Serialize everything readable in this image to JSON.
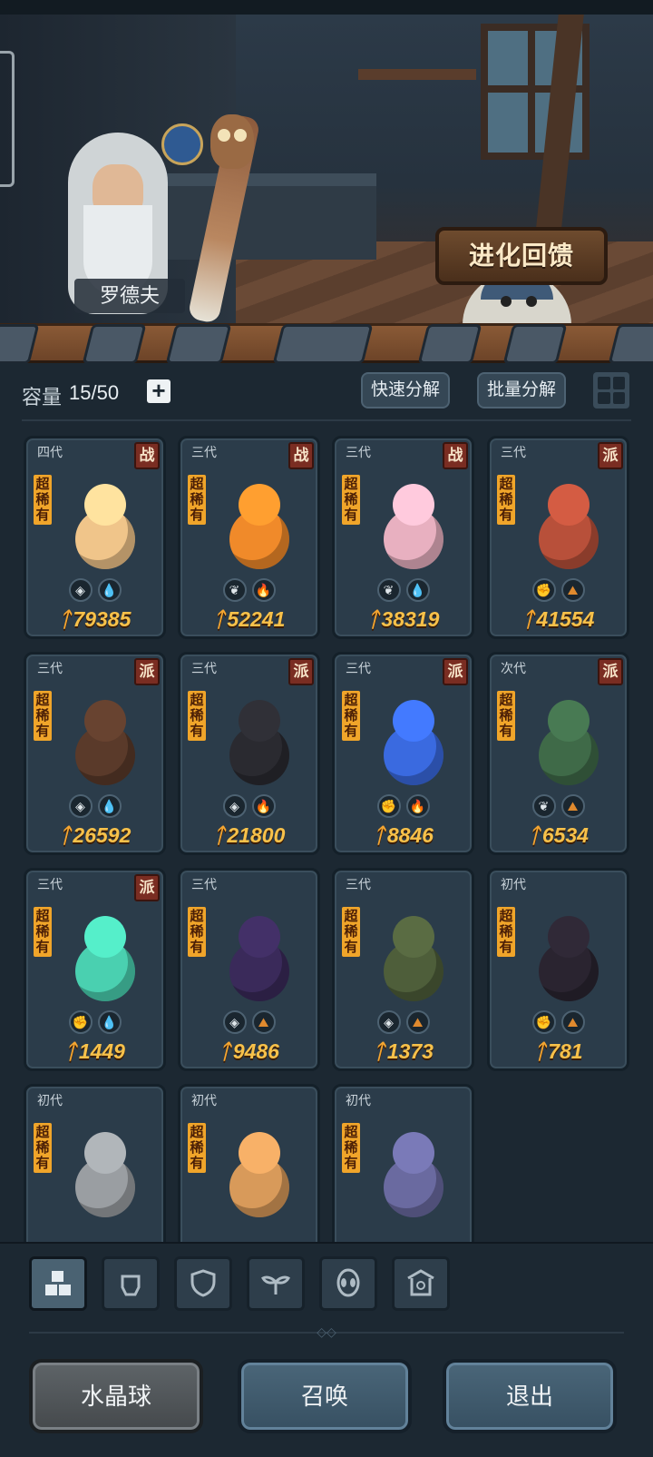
{
  "scene": {
    "npc_name": "罗德夫",
    "evolution_button": "进化回馈"
  },
  "capacity": {
    "label": "容量",
    "value": "15/50",
    "plus_symbol": "+"
  },
  "toolbar": {
    "quick_decompose": "快速分解",
    "batch_decompose": "批量分解"
  },
  "cards": [
    {
      "gen": "四代",
      "badge": "战",
      "rarity": "超稀有",
      "icons": [
        "shield-icon",
        "water-icon"
      ],
      "power": "79385",
      "color": "#f0c58a"
    },
    {
      "gen": "三代",
      "badge": "战",
      "rarity": "超稀有",
      "icons": [
        "leaf-icon",
        "fire-icon"
      ],
      "power": "52241",
      "color": "#f08a2a"
    },
    {
      "gen": "三代",
      "badge": "战",
      "rarity": "超稀有",
      "icons": [
        "leaf-icon",
        "water-icon"
      ],
      "power": "38319",
      "color": "#e8b0c0"
    },
    {
      "gen": "三代",
      "badge": "派",
      "rarity": "超稀有",
      "icons": [
        "fist-icon",
        "earth-icon"
      ],
      "power": "41554",
      "color": "#b8503a"
    },
    {
      "gen": "三代",
      "badge": "派",
      "rarity": "超稀有",
      "icons": [
        "shield-icon",
        "water-icon"
      ],
      "power": "26592",
      "color": "#5a3a2a"
    },
    {
      "gen": "三代",
      "badge": "派",
      "rarity": "超稀有",
      "icons": [
        "shield-icon",
        "fire-icon"
      ],
      "power": "21800",
      "color": "#2a2a30"
    },
    {
      "gen": "三代",
      "badge": "派",
      "rarity": "超稀有",
      "icons": [
        "fist-icon",
        "fire-icon"
      ],
      "power": "8846",
      "color": "#3a6ae0"
    },
    {
      "gen": "次代",
      "badge": "派",
      "rarity": "超稀有",
      "icons": [
        "leaf-icon",
        "earth-icon"
      ],
      "power": "6534",
      "color": "#3f6a48"
    },
    {
      "gen": "三代",
      "badge": "派",
      "rarity": "超稀有",
      "icons": [
        "fist-icon",
        "water-icon"
      ],
      "power": "1449",
      "color": "#4ad0b0"
    },
    {
      "gen": "三代",
      "badge": "",
      "rarity": "超稀有",
      "icons": [
        "shield-icon",
        "earth-icon"
      ],
      "power": "9486",
      "color": "#3a2a5a"
    },
    {
      "gen": "三代",
      "badge": "",
      "rarity": "超稀有",
      "icons": [
        "shield-icon",
        "earth-icon"
      ],
      "power": "1373",
      "color": "#4e5e3a"
    },
    {
      "gen": "初代",
      "badge": "",
      "rarity": "超稀有",
      "icons": [
        "fist-icon",
        "earth-icon"
      ],
      "power": "781",
      "color": "#2a2430"
    },
    {
      "gen": "初代",
      "badge": "",
      "rarity": "超稀有",
      "icons": [],
      "power": "",
      "color": "#9a9ea2"
    },
    {
      "gen": "初代",
      "badge": "",
      "rarity": "超稀有",
      "icons": [],
      "power": "",
      "color": "#d89a5a"
    },
    {
      "gen": "初代",
      "badge": "",
      "rarity": "超稀有",
      "icons": [],
      "power": "",
      "color": "#6a6aa0"
    }
  ],
  "power_symbol": "ᛏ",
  "filters": [
    {
      "name": "filter-all-icon",
      "active": true
    },
    {
      "name": "filter-fist-icon",
      "active": false
    },
    {
      "name": "filter-shield-icon",
      "active": false
    },
    {
      "name": "filter-leaf-icon",
      "active": false
    },
    {
      "name": "filter-alien-icon",
      "active": false
    },
    {
      "name": "filter-shrine-icon",
      "active": false
    }
  ],
  "buttons": {
    "crystal_ball": "水晶球",
    "summon": "召唤",
    "exit": "退出"
  }
}
